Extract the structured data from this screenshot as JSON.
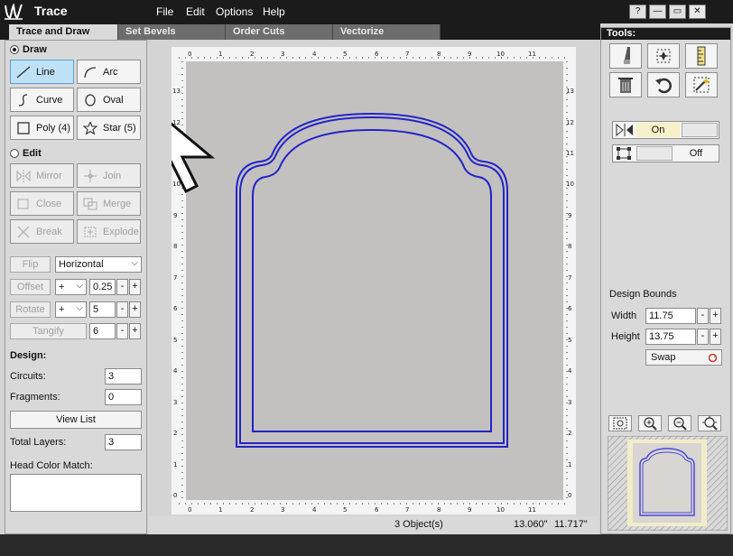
{
  "app": {
    "title": "Trace"
  },
  "menu": [
    "File",
    "Edit",
    "Options",
    "Help"
  ],
  "window_controls": {
    "help": "?",
    "minimize": "—",
    "restore": "▭",
    "close": "✕"
  },
  "tabs": [
    "Trace and Draw",
    "Set Bevels",
    "Order Cuts",
    "Vectorize"
  ],
  "draw": {
    "heading": "Draw",
    "tools": [
      "Line",
      "Arc",
      "Curve",
      "Oval",
      "Poly (4)",
      "Star (5)"
    ]
  },
  "edit": {
    "heading": "Edit",
    "tools": [
      "Mirror",
      "Join",
      "Close",
      "Merge",
      "Break",
      "Explode"
    ]
  },
  "transform": {
    "flip_label": "Flip",
    "flip_option": "Horizontal",
    "offset_label": "Offset",
    "offset_sign": "+",
    "offset_value": "0.25",
    "rotate_label": "Rotate",
    "rotate_sign": "+",
    "rotate_value": "5",
    "tangify_label": "Tangify",
    "tangify_value": "6"
  },
  "design": {
    "heading": "Design:",
    "circuits_label": "Circuits:",
    "circuits_value": "3",
    "fragments_label": "Fragments:",
    "fragments_value": "0",
    "view_list_label": "View List",
    "total_layers_label": "Total Layers:",
    "total_layers_value": "3",
    "head_color_label": "Head Color Match:"
  },
  "ruler": {
    "x_ticks": [
      "0",
      "1",
      "2",
      "3",
      "4",
      "5",
      "6",
      "7",
      "8",
      "9",
      "10",
      "11"
    ],
    "y_ticks": [
      "13",
      "12",
      "11",
      "10",
      "9",
      "8",
      "7",
      "6",
      "5",
      "4",
      "3",
      "2",
      "1",
      "0"
    ]
  },
  "status": {
    "objects": "3 Object(s)",
    "coord_x": "13.060\"",
    "coord_y": "11.717\""
  },
  "tools_panel": {
    "title": "Tools:",
    "mirror_toggle_label": "On",
    "bounds_toggle_label": "Off"
  },
  "design_bounds": {
    "heading": "Design Bounds",
    "width_label": "Width",
    "width_value": "11.75",
    "height_label": "Height",
    "height_value": "13.75",
    "swap_label": "Swap"
  },
  "colors": {
    "accent": "#2323c8",
    "title_bar": "#1b1b1b",
    "canvas": "#c3c1bf"
  }
}
